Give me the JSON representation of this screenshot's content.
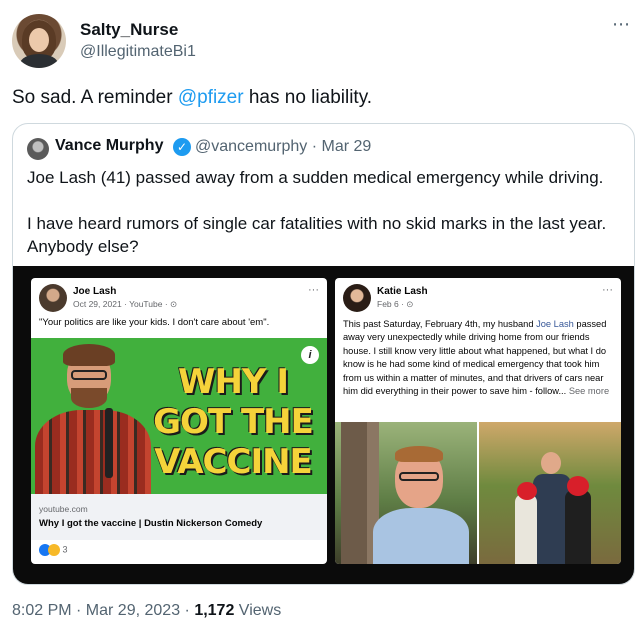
{
  "author": {
    "display_name": "Salty_Nurse",
    "handle": "@IllegitimateBi1"
  },
  "more_icon": "⋯",
  "tweet": {
    "text_before": "So sad. A reminder ",
    "mention": "@pfizer",
    "text_after": " has no liability."
  },
  "quoted": {
    "display_name": "Vance Murphy",
    "verified_mark": "✓",
    "handle_date": "@vancemurphy · Mar 29",
    "paragraphs": [
      "Joe Lash (41) passed away from a sudden medical emergency while driving.",
      "I have heard rumors of single car fatalities with no skid marks in the last year. Anybody else?"
    ],
    "card1": {
      "name": "Joe Lash",
      "meta": "Oct 29, 2021 · YouTube · ⊙",
      "dots": "···",
      "text": "\"Your politics are like your kids. I don't care about 'em\".",
      "video_title": "WHY I GOT THE VACCINE",
      "info_icon": "i",
      "link_domain": "youtube.com",
      "link_title": "Why I got the vaccine | Dustin Nickerson Comedy",
      "reaction_count": "3"
    },
    "card2": {
      "name": "Katie Lash",
      "meta": "Feb 6 · ⊙",
      "dots": "···",
      "text_before": "This past Saturday, February 4th, my husband ",
      "link_name": "Joe Lash",
      "text_after": " passed away very unexpectedly while driving home from our friends house. I still know very little about what happened, but what I do know is he had some kind of medical emergency that took him from us within a matter of minutes, and that drivers of cars near him did everything in their power to save him - follow... ",
      "see_more": "See more"
    }
  },
  "footer": {
    "time": "8:02 PM · Mar 29, 2023 · ",
    "views_count": "1,172",
    "views_label": " Views"
  },
  "colors": {
    "link": "#1d9bf0",
    "secondary": "#536471",
    "verified": "#1d9bf0"
  }
}
